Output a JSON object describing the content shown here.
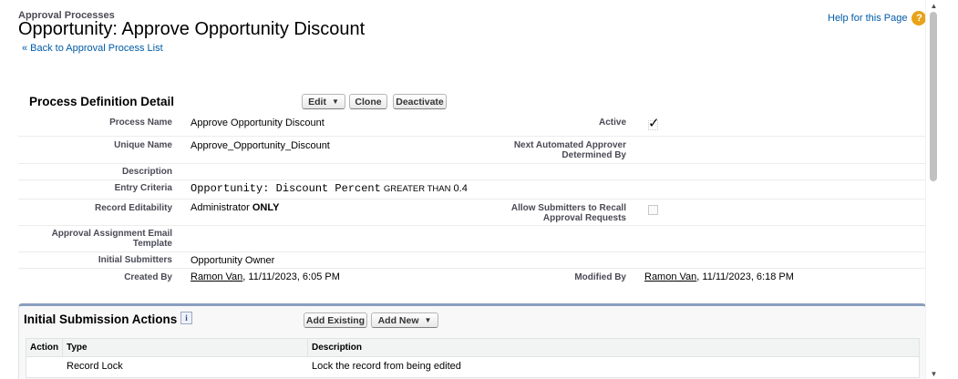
{
  "header": {
    "breadcrumb": "Approval Processes",
    "title": "Opportunity: Approve Opportunity Discount",
    "back_symbol": "«",
    "back_link": "Back to Approval Process List",
    "help_link": "Help for this Page",
    "help_icon": "?"
  },
  "detail": {
    "section_title": "Process Definition Detail",
    "buttons": {
      "edit": "Edit",
      "clone": "Clone",
      "deactivate": "Deactivate"
    },
    "fields": {
      "process_name_label": "Process Name",
      "process_name": "Approve Opportunity Discount",
      "active_label": "Active",
      "active_check": "✓",
      "unique_name_label": "Unique Name",
      "unique_name": "Approve_Opportunity_Discount",
      "next_approver_label_1": "Next Automated Approver",
      "next_approver_label_2": "Determined By",
      "description_label": "Description",
      "entry_criteria_label": "Entry Criteria",
      "entry_criteria_field": "Opportunity: Discount Percent",
      "entry_criteria_op": "GREATER THAN",
      "entry_criteria_value": "0.4",
      "record_editability_label": "Record Editability",
      "record_editability_value": "Administrator",
      "record_editability_suffix": "ONLY",
      "allow_recall_label_1": "Allow Submitters to Recall",
      "allow_recall_label_2": "Approval Requests",
      "email_template_label_1": "Approval Assignment Email",
      "email_template_label_2": "Template",
      "initial_submitters_label": "Initial Submitters",
      "initial_submitters": "Opportunity Owner",
      "created_by_label": "Created By",
      "created_by_user": "Ramon Van",
      "created_by_date": ", 11/11/2023, 6:05 PM",
      "modified_by_label": "Modified By",
      "modified_by_user": "Ramon Van",
      "modified_by_date": ", 11/11/2023, 6:18 PM"
    }
  },
  "initial_submission": {
    "title": "Initial Submission Actions",
    "info_icon": "i",
    "buttons": {
      "add_existing": "Add Existing",
      "add_new": "Add New"
    },
    "columns": [
      "Action",
      "Type",
      "Description"
    ],
    "rows": [
      {
        "action": "",
        "type": "Record Lock",
        "description": "Lock the record from being edited"
      }
    ]
  },
  "scrollbar": {
    "up_icon": "▲",
    "down_icon": "▼"
  }
}
